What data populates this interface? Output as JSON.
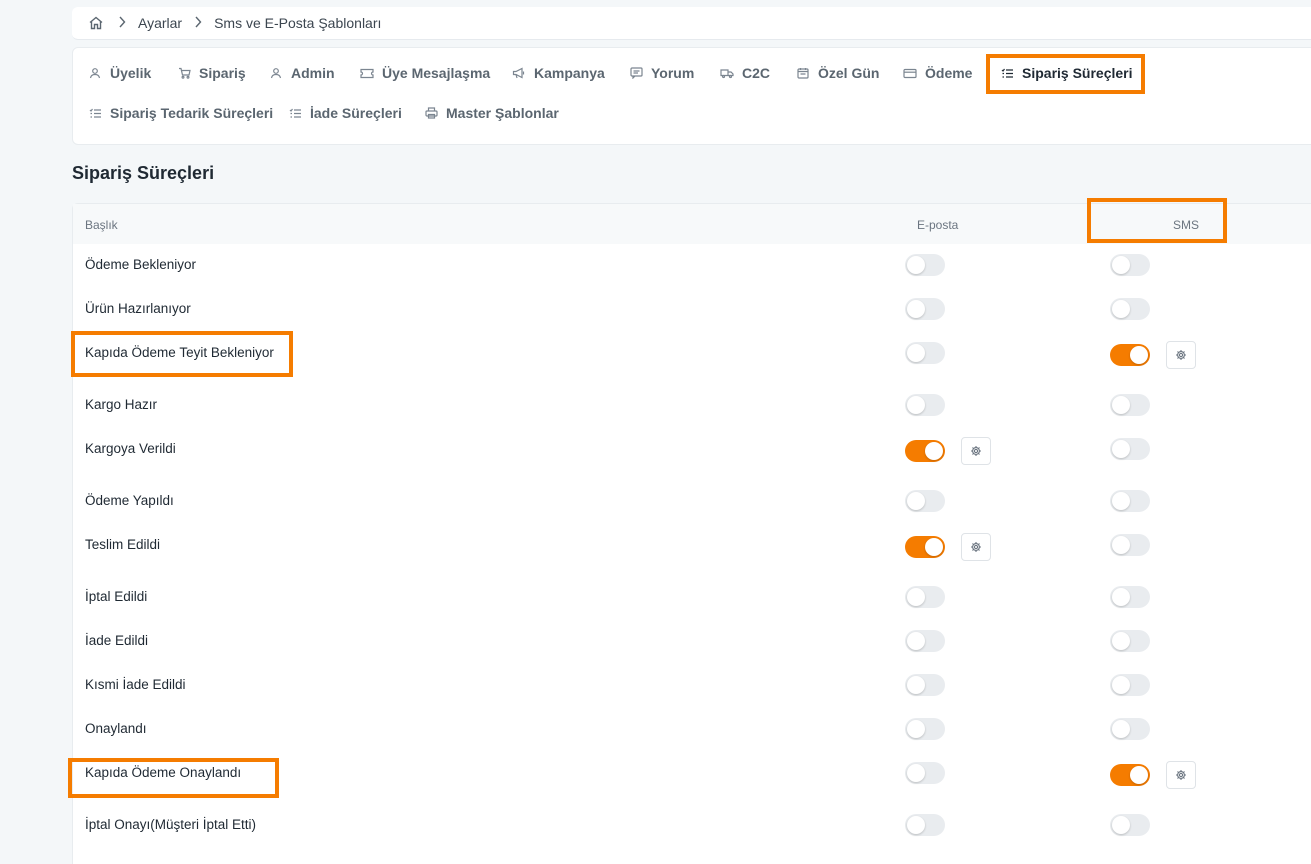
{
  "breadcrumb": {
    "items": [
      "Ayarlar",
      "Sms ve E-Posta Şablonları"
    ]
  },
  "tabs": [
    {
      "label": "Üyelik",
      "icon": "user-icon"
    },
    {
      "label": "Sipariş",
      "icon": "cart-icon"
    },
    {
      "label": "Admin",
      "icon": "user-icon"
    },
    {
      "label": "Üye Mesajlaşma",
      "icon": "ticket-icon"
    },
    {
      "label": "Kampanya",
      "icon": "megaphone-icon"
    },
    {
      "label": "Yorum",
      "icon": "comment-icon"
    },
    {
      "label": "C2C",
      "icon": "truck-icon"
    },
    {
      "label": "Özel Gün",
      "icon": "calendar-icon"
    },
    {
      "label": "Ödeme",
      "icon": "card-icon"
    },
    {
      "label": "Sipariş Süreçleri",
      "icon": "list-check-icon",
      "active": true
    },
    {
      "label": "Sipariş Tedarik Süreçleri",
      "icon": "list-check-icon"
    },
    {
      "label": "İade Süreçleri",
      "icon": "list-check-icon"
    },
    {
      "label": "Master Şablonlar",
      "icon": "printer-icon"
    }
  ],
  "section_title": "Sipariş Süreçleri",
  "table": {
    "headers": {
      "title": "Başlık",
      "email": "E-posta",
      "sms": "SMS"
    },
    "rows": [
      {
        "label": "Ödeme Bekleniyor",
        "email": false,
        "sms": false
      },
      {
        "label": "Ürün Hazırlanıyor",
        "email": false,
        "sms": false
      },
      {
        "label": "Kapıda Ödeme Teyit Bekleniyor",
        "email": false,
        "sms": true
      },
      {
        "label": "Kargo Hazır",
        "email": false,
        "sms": false
      },
      {
        "label": "Kargoya Verildi",
        "email": true,
        "sms": false
      },
      {
        "label": "Ödeme Yapıldı",
        "email": false,
        "sms": false
      },
      {
        "label": "Teslim Edildi",
        "email": true,
        "sms": false
      },
      {
        "label": "İptal Edildi",
        "email": false,
        "sms": false
      },
      {
        "label": "İade Edildi",
        "email": false,
        "sms": false
      },
      {
        "label": "Kısmi İade Edildi",
        "email": false,
        "sms": false
      },
      {
        "label": "Onaylandı",
        "email": false,
        "sms": false
      },
      {
        "label": "Kapıda Ödeme Onaylandı",
        "email": false,
        "sms": true
      },
      {
        "label": "İptal Onayı(Müşteri İptal Etti)",
        "email": false,
        "sms": false
      }
    ]
  },
  "colors": {
    "accent": "#f57c00",
    "highlight": "#f57c00"
  }
}
